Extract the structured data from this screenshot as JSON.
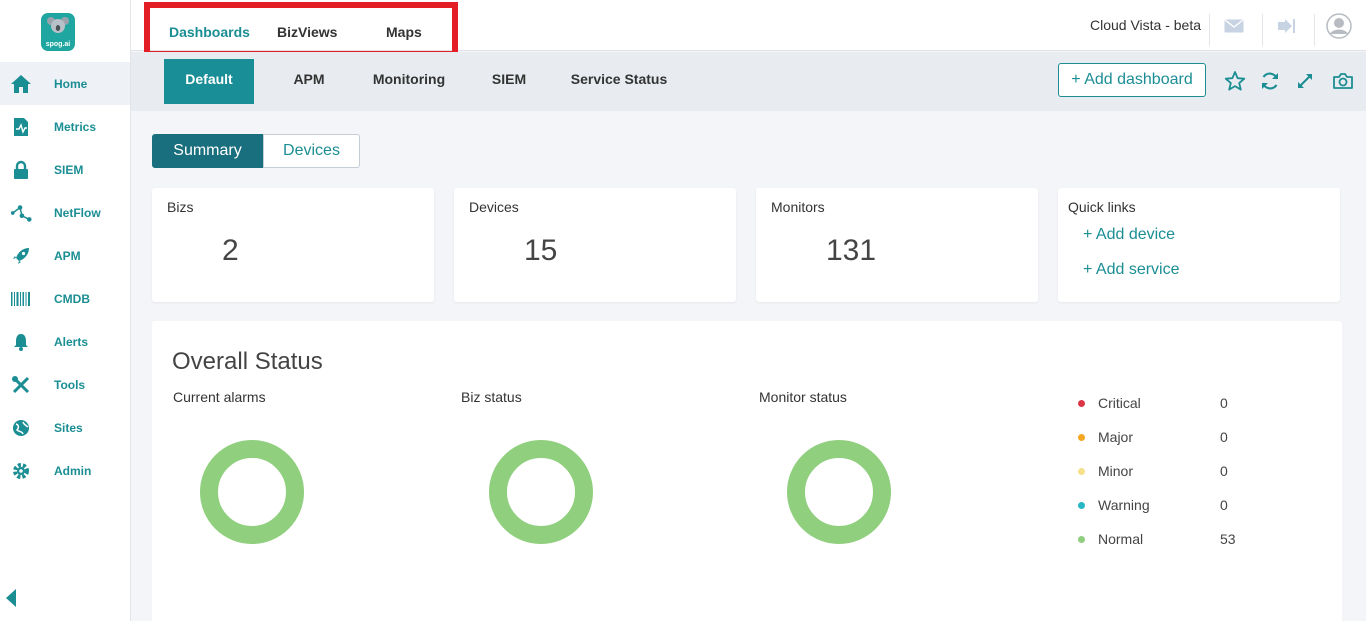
{
  "logo": {
    "brand_text": "spog.ai"
  },
  "sidebar": {
    "items": [
      {
        "label": "Home",
        "icon": "home-icon"
      },
      {
        "label": "Metrics",
        "icon": "metrics-icon"
      },
      {
        "label": "SIEM",
        "icon": "lock-icon"
      },
      {
        "label": "NetFlow",
        "icon": "netflow-icon"
      },
      {
        "label": "APM",
        "icon": "rocket-icon"
      },
      {
        "label": "CMDB",
        "icon": "barcode-icon"
      },
      {
        "label": "Alerts",
        "icon": "bell-icon"
      },
      {
        "label": "Tools",
        "icon": "tools-icon"
      },
      {
        "label": "Sites",
        "icon": "globe-icon"
      },
      {
        "label": "Admin",
        "icon": "gear-icon"
      }
    ],
    "active": "Home"
  },
  "topbar": {
    "tabs": [
      "Dashboards",
      "BizViews",
      "Maps"
    ],
    "active_tab": "Dashboards",
    "account_label": "Cloud Vista - beta"
  },
  "dashboard_tabs": {
    "tabs": [
      "Default",
      "APM",
      "Monitoring",
      "SIEM",
      "Service Status"
    ],
    "active": "Default",
    "add_label": "+ Add dashboard"
  },
  "view_toggle": {
    "options": [
      "Summary",
      "Devices"
    ],
    "active": "Summary"
  },
  "stats": {
    "bizs": {
      "title": "Bizs",
      "value": "2"
    },
    "devices": {
      "title": "Devices",
      "value": "15"
    },
    "monitors": {
      "title": "Monitors",
      "value": "131"
    }
  },
  "quick_links": {
    "title": "Quick links",
    "links": [
      "+ Add device",
      "+ Add service"
    ]
  },
  "overall_status": {
    "title": "Overall Status",
    "charts": [
      "Current alarms",
      "Biz status",
      "Monitor status"
    ],
    "legend": [
      {
        "name": "Critical",
        "count": "0",
        "color": "#dc3545"
      },
      {
        "name": "Major",
        "count": "0",
        "color": "#f5a623"
      },
      {
        "name": "Minor",
        "count": "0",
        "color": "#f7e08a"
      },
      {
        "name": "Warning",
        "count": "0",
        "color": "#26b6c4"
      },
      {
        "name": "Normal",
        "count": "53",
        "color": "#8fcf7e"
      }
    ],
    "donut_color": "#8fcf7e"
  },
  "colors": {
    "accent": "#1b8e94",
    "highlight_box": "#e41e26"
  }
}
